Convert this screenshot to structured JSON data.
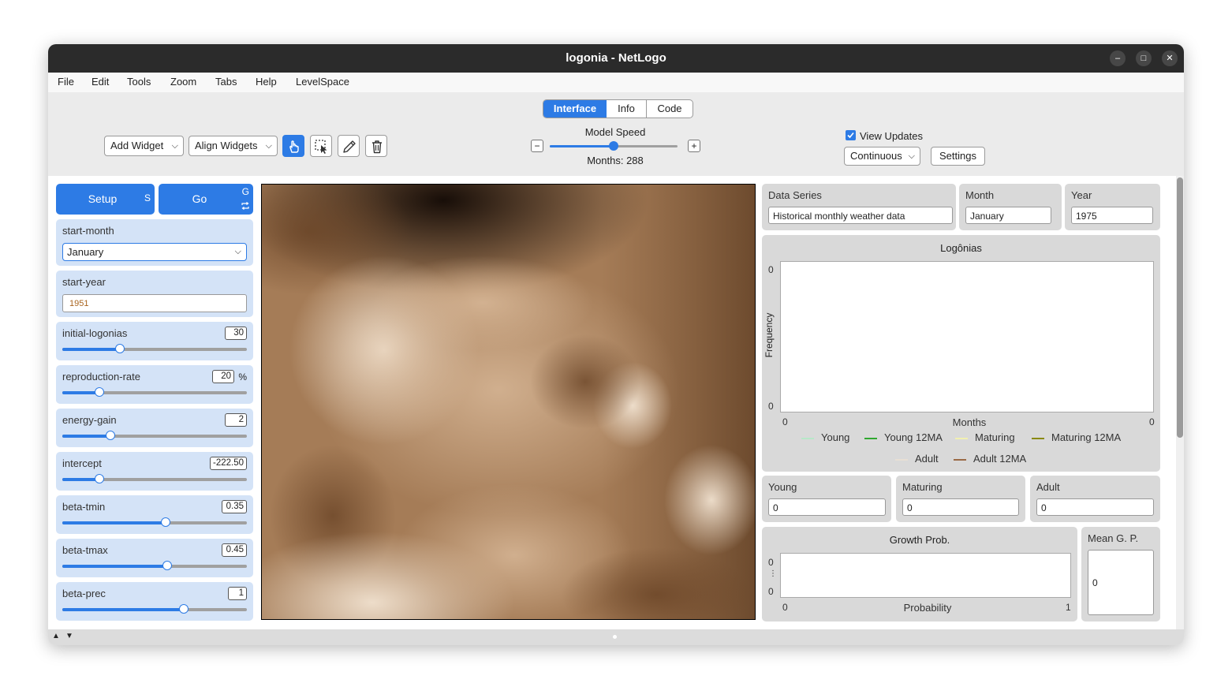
{
  "window": {
    "title": "logonia - NetLogo",
    "controls": {
      "minimize": "–",
      "maximize": "□",
      "close": "✕"
    }
  },
  "menu": [
    "File",
    "Edit",
    "Tools",
    "Zoom",
    "Tabs",
    "Help",
    "LevelSpace"
  ],
  "tabs": {
    "interface": "Interface",
    "info": "Info",
    "code": "Code",
    "active": "Interface"
  },
  "toolbar": {
    "add_widget": "Add Widget",
    "align_widgets": "Align Widgets",
    "model_speed_label": "Model Speed",
    "model_speed_minus": "−",
    "model_speed_plus": "+",
    "model_speed_fraction": 0.5,
    "months_readout": "Months: 288",
    "view_updates_label": "View Updates",
    "view_updates_checked": true,
    "update_mode": "Continuous",
    "settings_label": "Settings"
  },
  "buttons": {
    "setup": {
      "label": "Setup",
      "key": "S"
    },
    "go": {
      "label": "Go",
      "key": "G"
    }
  },
  "chooser": {
    "label": "start-month",
    "value": "January"
  },
  "input_start_year": {
    "label": "start-year",
    "value": "1951"
  },
  "sliders": [
    {
      "label": "initial-logonias",
      "value": "30",
      "fraction": 0.31,
      "unit": ""
    },
    {
      "label": "reproduction-rate",
      "value": "20",
      "fraction": 0.2,
      "unit": "%"
    },
    {
      "label": "energy-gain",
      "value": "2",
      "fraction": 0.26,
      "unit": ""
    },
    {
      "label": "intercept",
      "value": "-222.50",
      "fraction": 0.2,
      "unit": ""
    },
    {
      "label": "beta-tmin",
      "value": "0.35",
      "fraction": 0.56,
      "unit": ""
    },
    {
      "label": "beta-tmax",
      "value": "0.45",
      "fraction": 0.57,
      "unit": ""
    },
    {
      "label": "beta-prec",
      "value": "1",
      "fraction": 0.66,
      "unit": ""
    }
  ],
  "monitors_top": {
    "data_series": {
      "label": "Data Series",
      "value": "Historical monthly weather data"
    },
    "month": {
      "label": "Month",
      "value": "January"
    },
    "year": {
      "label": "Year",
      "value": "1975"
    }
  },
  "plot_logonias": {
    "title": "Logônias",
    "ylabel": "Frequency",
    "xlabel": "Months",
    "y_max": "0",
    "y_min": "0",
    "x_min": "0",
    "x_max": "0",
    "legend": [
      {
        "name": "Young",
        "color": "#b7e8c8"
      },
      {
        "name": "Young 12MA",
        "color": "#2fa82f"
      },
      {
        "name": "Maturing",
        "color": "#f2f0b0"
      },
      {
        "name": "Maturing 12MA",
        "color": "#8a8a12"
      },
      {
        "name": "Adult",
        "color": "#e8dfd4"
      },
      {
        "name": "Adult 12MA",
        "color": "#9a6a45"
      }
    ]
  },
  "monitors_counts": {
    "young": {
      "label": "Young",
      "value": "0"
    },
    "maturing": {
      "label": "Maturing",
      "value": "0"
    },
    "adult": {
      "label": "Adult",
      "value": "0"
    }
  },
  "plot_growth": {
    "title": "Growth Prob.",
    "xlabel": "Probability",
    "y_top": "0",
    "y_ellipsis": "⋮",
    "y_bottom": "0",
    "x_min": "0",
    "x_max": "1"
  },
  "monitor_mean_gp": {
    "label": "Mean G. P.",
    "value": "0"
  },
  "colors": {
    "accent": "#2d7be5",
    "widget_blue": "#d4e3f7",
    "widget_gray": "#d9d9d9",
    "titlebar": "#2b2b2b"
  },
  "icons": [
    "interact-hand-icon",
    "select-icon",
    "edit-pencil-icon",
    "delete-trash-icon",
    "checkbox-icon",
    "forever-loop-icon"
  ]
}
